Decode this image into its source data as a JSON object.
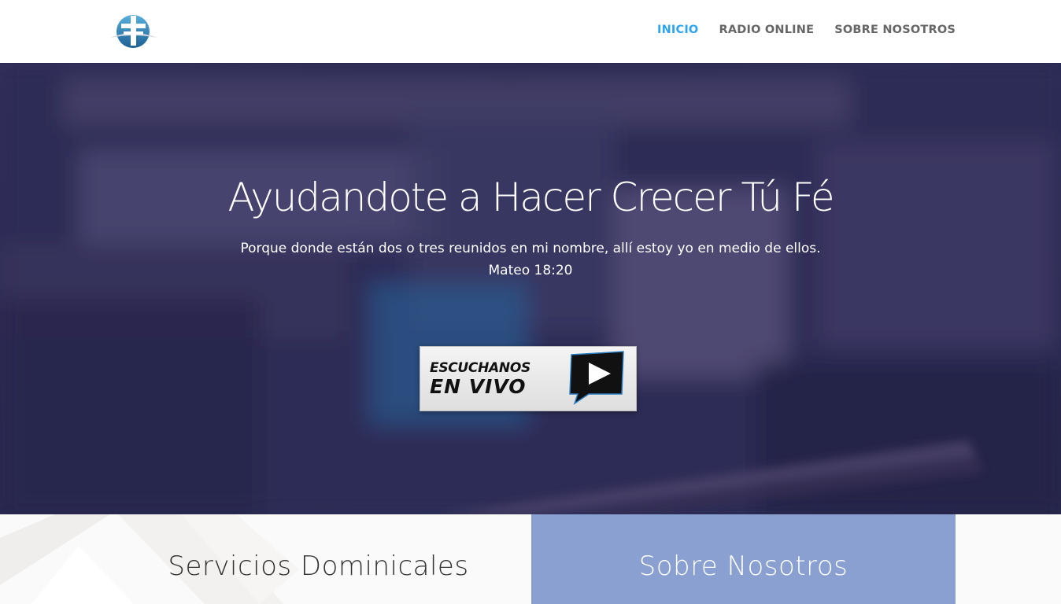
{
  "header": {
    "nav": [
      {
        "label": "INICIO",
        "active": true
      },
      {
        "label": "RADIO ONLINE",
        "active": false
      },
      {
        "label": "SOBRE NOSOTROS",
        "active": false
      }
    ],
    "accent_color": "#2ea3f2"
  },
  "hero": {
    "title": "Ayudandote a  Hacer Crecer Tú  Fé",
    "subtitle": "Porque donde están dos o tres reunidos en mi nombre, allí estoy yo en medio de ellos.",
    "reference": "Mateo 18:20",
    "live_button": {
      "line1": "ESCUCHANOS",
      "line2": "EN VIVO",
      "icon": "play-icon"
    }
  },
  "sections": {
    "left": {
      "title": "Servicios Dominicales"
    },
    "right": {
      "title": "Sobre Nosotros",
      "background": "#8aa0d1"
    }
  }
}
